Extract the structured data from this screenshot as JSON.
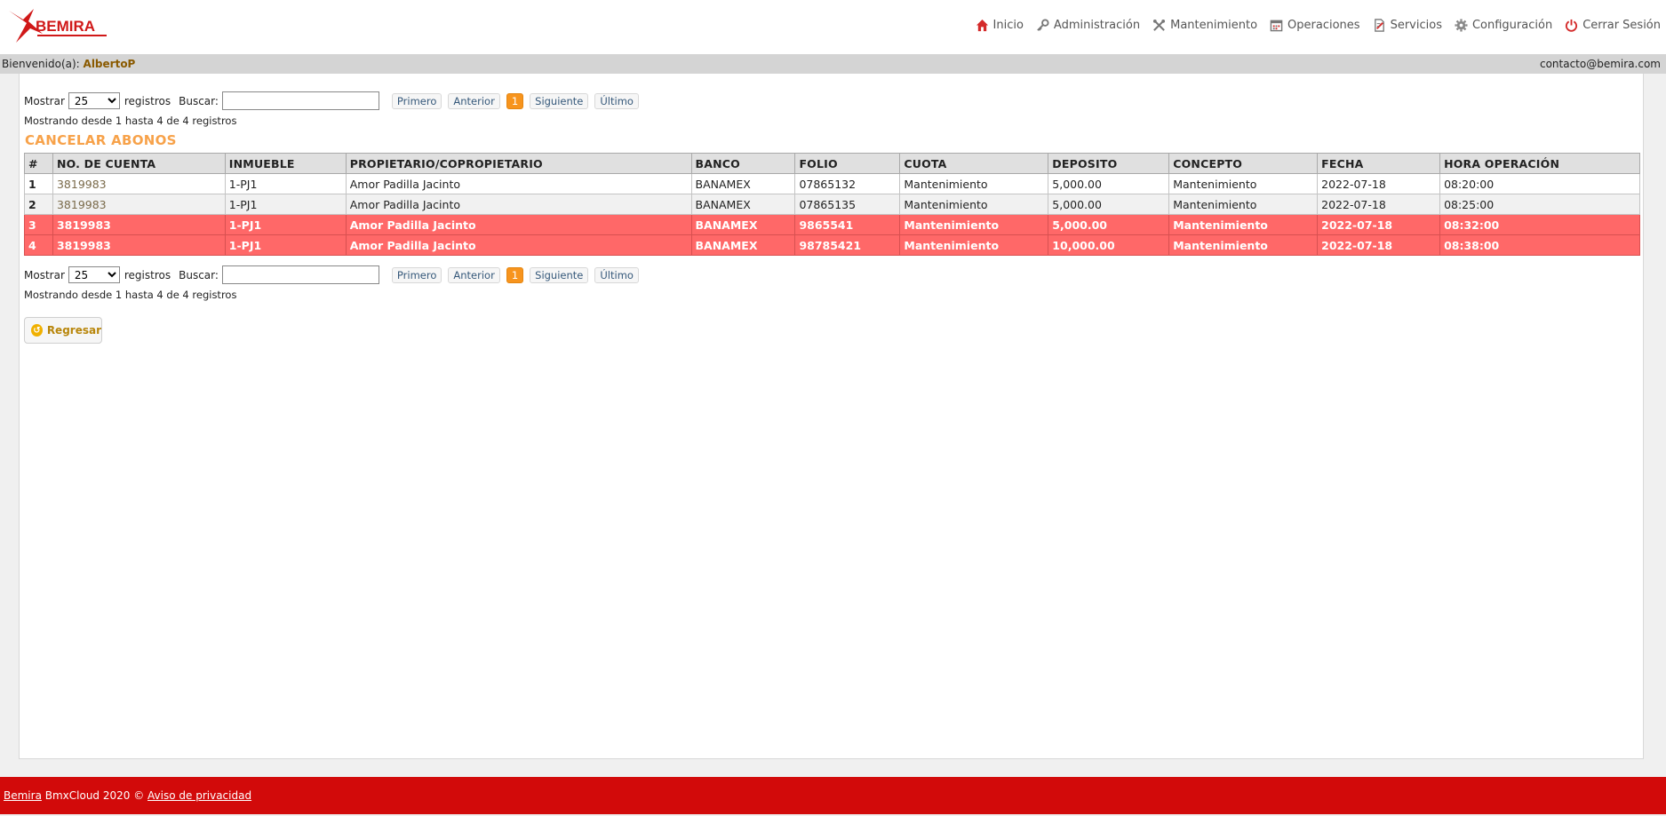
{
  "brand": {
    "name": "BEMIRA"
  },
  "nav": [
    {
      "label": "Inicio",
      "icon": "home-icon"
    },
    {
      "label": "Administración",
      "icon": "key-icon"
    },
    {
      "label": "Mantenimiento",
      "icon": "tools-icon"
    },
    {
      "label": "Operaciones",
      "icon": "calendar-icon"
    },
    {
      "label": "Servicios",
      "icon": "document-icon"
    },
    {
      "label": "Configuración",
      "icon": "gear-icon"
    },
    {
      "label": "Cerrar Sesión",
      "icon": "power-icon"
    }
  ],
  "welcome": {
    "prefix": "Bienvenido(a):",
    "user": "AlbertoP",
    "email": "contacto@bemira.com"
  },
  "controls": {
    "show_label": "Mostrar",
    "show_value": "25",
    "records_label": "registros",
    "search_label": "Buscar:",
    "search_value": "",
    "pager": {
      "first": "Primero",
      "prev": "Anterior",
      "current": "1",
      "next": "Siguiente",
      "last": "Último"
    },
    "info": "Mostrando desde 1 hasta 4 de 4 registros"
  },
  "section_title": "CANCELAR ABONOS",
  "table": {
    "headers": [
      "#",
      "NO. DE CUENTA",
      "INMUEBLE",
      "PROPIETARIO/COPROPIETARIO",
      "BANCO",
      "FOLIO",
      "CUOTA",
      "DEPOSITO",
      "CONCEPTO",
      "FECHA",
      "HORA OPERACIÓN"
    ],
    "rows": [
      {
        "num": "1",
        "cuenta": "3819983",
        "inmueble": "1-PJ1",
        "propietario": "Amor Padilla Jacinto",
        "banco": "BANAMEX",
        "folio": "07865132",
        "cuota": "Mantenimiento",
        "deposito": "5,000.00",
        "concepto": "Mantenimiento",
        "fecha": "2022-07-18",
        "hora": "08:20:00",
        "status": "normal"
      },
      {
        "num": "2",
        "cuenta": "3819983",
        "inmueble": "1-PJ1",
        "propietario": "Amor Padilla Jacinto",
        "banco": "BANAMEX",
        "folio": "07865135",
        "cuota": "Mantenimiento",
        "deposito": "5,000.00",
        "concepto": "Mantenimiento",
        "fecha": "2022-07-18",
        "hora": "08:25:00",
        "status": "normal"
      },
      {
        "num": "3",
        "cuenta": "3819983",
        "inmueble": "1-PJ1",
        "propietario": "Amor Padilla Jacinto",
        "banco": "BANAMEX",
        "folio": "9865541",
        "cuota": "Mantenimiento",
        "deposito": "5,000.00",
        "concepto": "Mantenimiento",
        "fecha": "2022-07-18",
        "hora": "08:32:00",
        "status": "highlighted"
      },
      {
        "num": "4",
        "cuenta": "3819983",
        "inmueble": "1-PJ1",
        "propietario": "Amor Padilla Jacinto",
        "banco": "BANAMEX",
        "folio": "98785421",
        "cuota": "Mantenimiento",
        "deposito": "10,000.00",
        "concepto": "Mantenimiento",
        "fecha": "2022-07-18",
        "hora": "08:38:00",
        "status": "highlighted"
      }
    ]
  },
  "back_button": "Regresar",
  "footer": {
    "brand_link": "Bemira",
    "text": " BmxCloud 2020 © ",
    "privacy_link": "Aviso de privacidad"
  },
  "colors": {
    "accent_orange": "#f7a24a",
    "highlight_row": "#ff6868",
    "footer_red": "#d20a0a"
  }
}
